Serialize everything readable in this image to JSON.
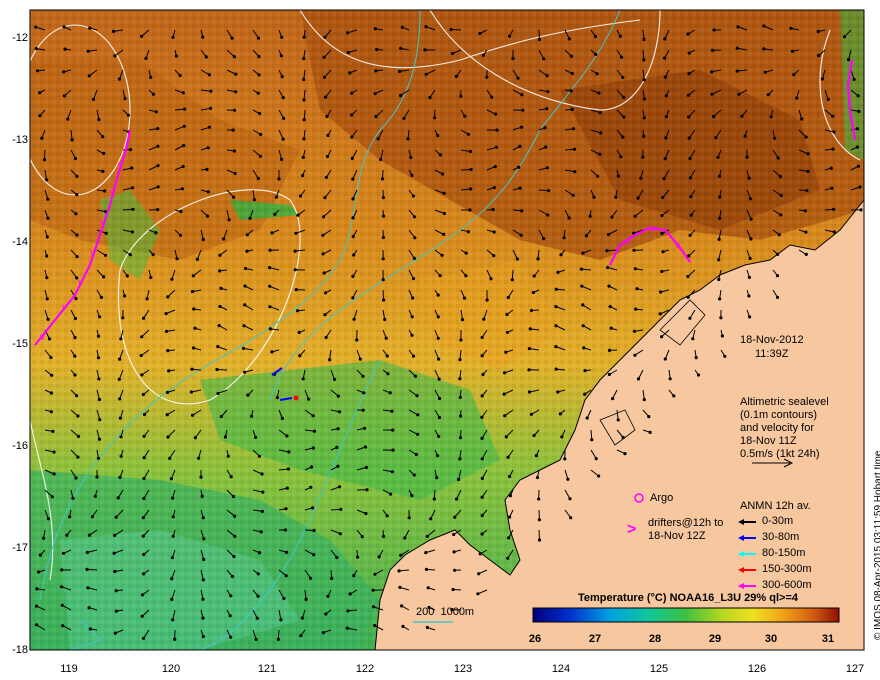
{
  "map": {
    "y_ticks": [
      "-12",
      "-13",
      "-14",
      "-15",
      "-16",
      "-17",
      "-18"
    ],
    "x_ticks": [
      "119",
      "120",
      "121",
      "122",
      "123",
      "124",
      "125",
      "126",
      "127"
    ],
    "date": "18-Nov-2012",
    "time": "11:39Z",
    "altimetry_note": [
      "Altimetric sealevel",
      "(0.1m contours)",
      "and velocity for",
      "18-Nov 11Z",
      "0.5m/s (1kt 24h)"
    ],
    "argo_label": "Argo",
    "drifters_label": [
      "drifters@12h to",
      "18-Nov 12Z"
    ],
    "anmn_title": "ANMN 12h av.",
    "anmn_rows": [
      {
        "label": "0-30m",
        "color": "#000000"
      },
      {
        "label": "30-80m",
        "color": "#0000ff"
      },
      {
        "label": "80-150m",
        "color": "#00ffff"
      },
      {
        "label": "150-300m",
        "color": "#ff0000"
      },
      {
        "label": "300-600m",
        "color": "#ff00ff"
      }
    ],
    "bathymetry_label": "200  1000m",
    "colorbar_title": "Temperature (°C) NOAA16_L3U 29% ql>=4",
    "colorbar_ticks": [
      "26",
      "27",
      "28",
      "29",
      "30",
      "31"
    ],
    "credit": "© IMOS 08-Apr-2015 03:11:59 Hobart time",
    "colors": {
      "land": "#f7c8a0",
      "sst_warm": "#b5560f",
      "sst_mid": "#e8a418",
      "sst_cool": "#4fb84a",
      "drifter": "#ff00ff",
      "bathy_contour": "#40c8c8"
    }
  }
}
